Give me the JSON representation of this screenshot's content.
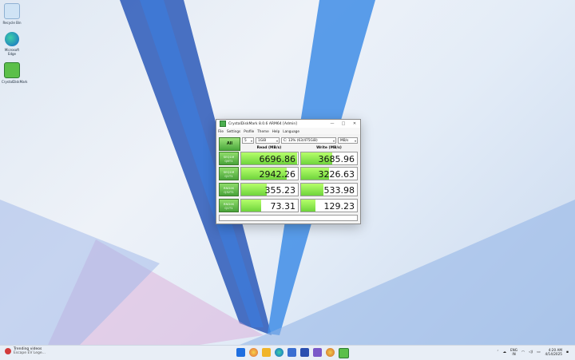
{
  "desktop": {
    "icons": [
      {
        "label": "Recycle Bin"
      },
      {
        "label": "Microsoft Edge"
      },
      {
        "label": "CrystalDiskMark"
      }
    ]
  },
  "window": {
    "title": "CrystalDiskMark 8.0.6 ARM64 [Admin]",
    "menu": [
      "File",
      "Settings",
      "Profile",
      "Theme",
      "Help",
      "Language"
    ],
    "all_button": "All",
    "count": "5",
    "size": "1GiB",
    "drive": "C: 13% (63/475GiB)",
    "unit": "MB/s",
    "read_header": "Read (MB/s)",
    "write_header": "Write (MB/s)",
    "rows": [
      {
        "label1": "SEQ1M",
        "label2": "Q8T1",
        "read": "6696.86",
        "write": "3685.96",
        "read_fill": 0.98,
        "write_fill": 0.55
      },
      {
        "label1": "SEQ1M",
        "label2": "Q1T1",
        "read": "2942.26",
        "write": "3226.63",
        "read_fill": 0.8,
        "write_fill": 0.5
      },
      {
        "label1": "RND4K",
        "label2": "Q32T1",
        "read": "355.23",
        "write": "533.98",
        "read_fill": 0.45,
        "write_fill": 0.4
      },
      {
        "label1": "RND4K",
        "label2": "Q1T1",
        "read": "73.31",
        "write": "129.23",
        "read_fill": 0.35,
        "write_fill": 0.25
      }
    ]
  },
  "taskbar": {
    "widget_title": "Trending videos",
    "widget_sub": "Escape EV Lege...",
    "lang1": "ENG",
    "lang2": "IN",
    "time": "4:20 AM",
    "date": "4/14/2025"
  }
}
